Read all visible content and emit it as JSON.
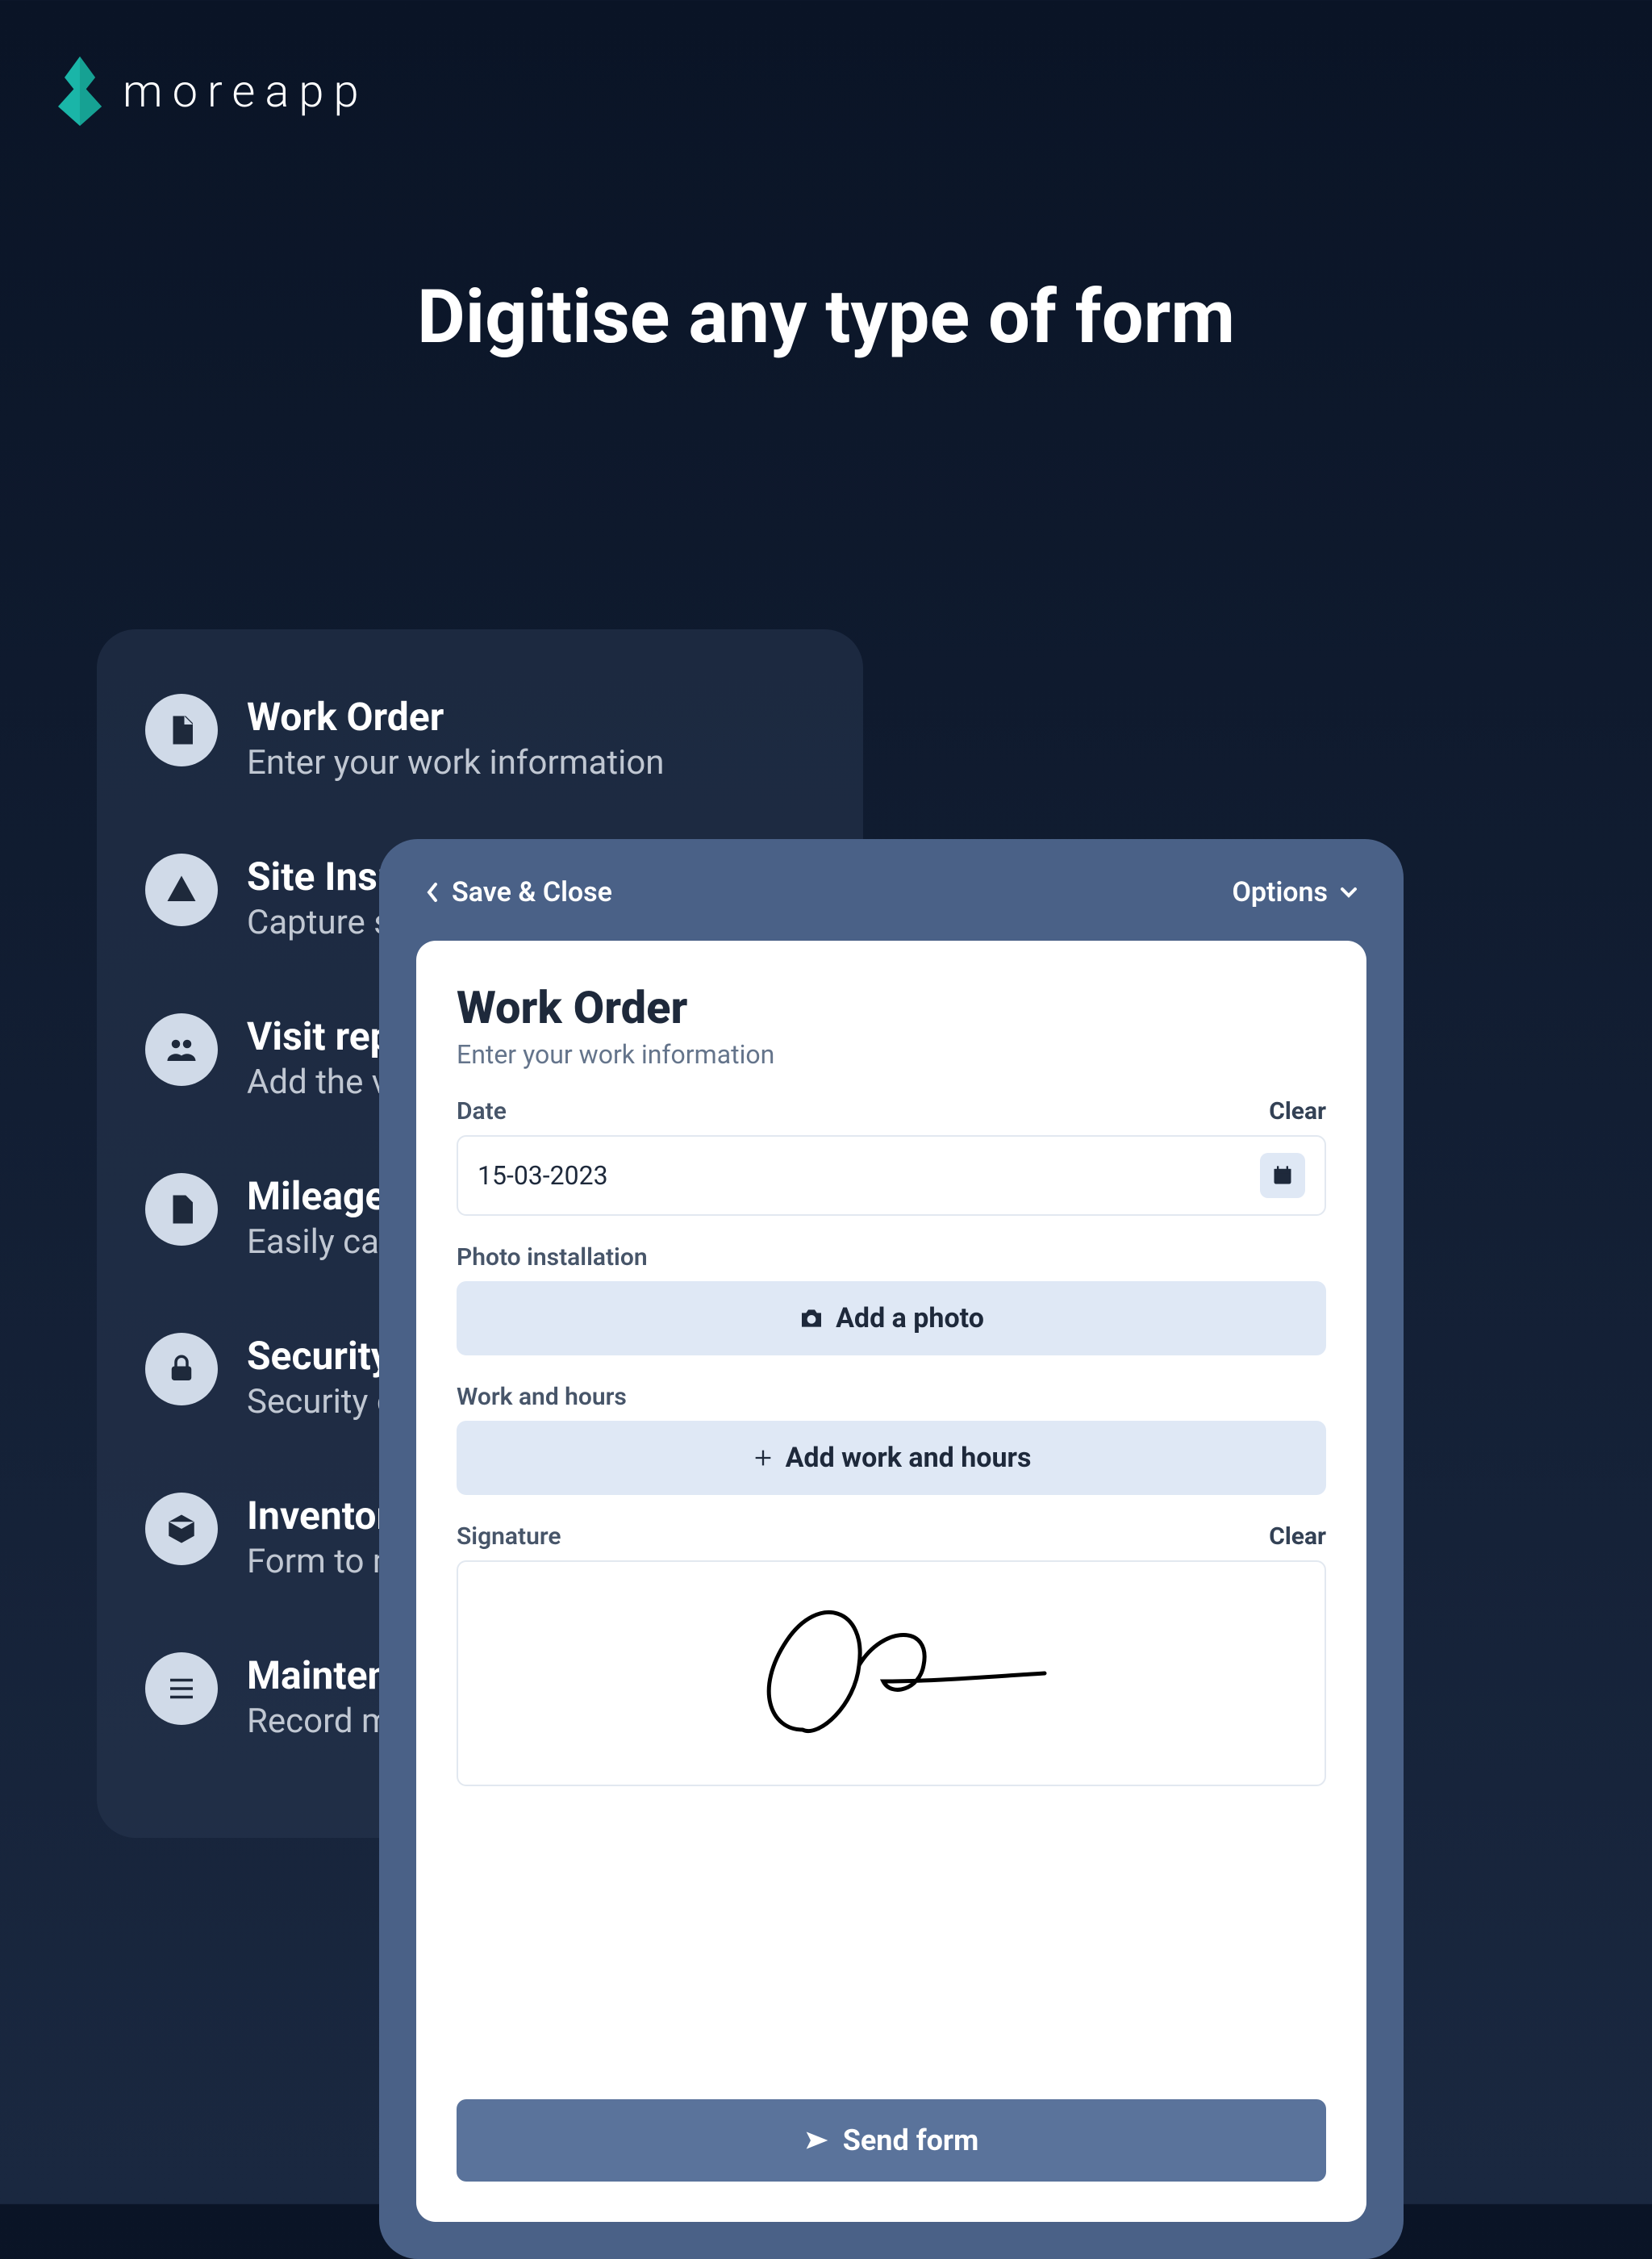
{
  "brand": {
    "name": "moreapp"
  },
  "headline": "Digitise any type of form",
  "sidebar": {
    "items": [
      {
        "title": "Work Order",
        "subtitle": "Enter your work information",
        "icon": "file"
      },
      {
        "title": "Site Inspection",
        "subtitle": "Capture site details",
        "icon": "warning"
      },
      {
        "title": "Visit report",
        "subtitle": "Add the visit details",
        "icon": "group"
      },
      {
        "title": "Mileage",
        "subtitle": "Easily calculate distances",
        "icon": "file"
      },
      {
        "title": "Security",
        "subtitle": "Security check form",
        "icon": "lock"
      },
      {
        "title": "Inventory",
        "subtitle": "Form to manage inventory",
        "icon": "cube"
      },
      {
        "title": "Maintenance",
        "subtitle": "Record maintenance tasks",
        "icon": "lines"
      }
    ]
  },
  "phone": {
    "back_label": "Save & Close",
    "options_label": "Options",
    "form_title": "Work Order",
    "form_subtitle": "Enter your work information",
    "date_label": "Date",
    "date_clear": "Clear",
    "date_value": "15-03-2023",
    "photo_label": "Photo installation",
    "photo_button": "Add a photo",
    "work_label": "Work and hours",
    "work_button": "Add work and hours",
    "signature_label": "Signature",
    "signature_clear": "Clear",
    "send_label": "Send form"
  }
}
